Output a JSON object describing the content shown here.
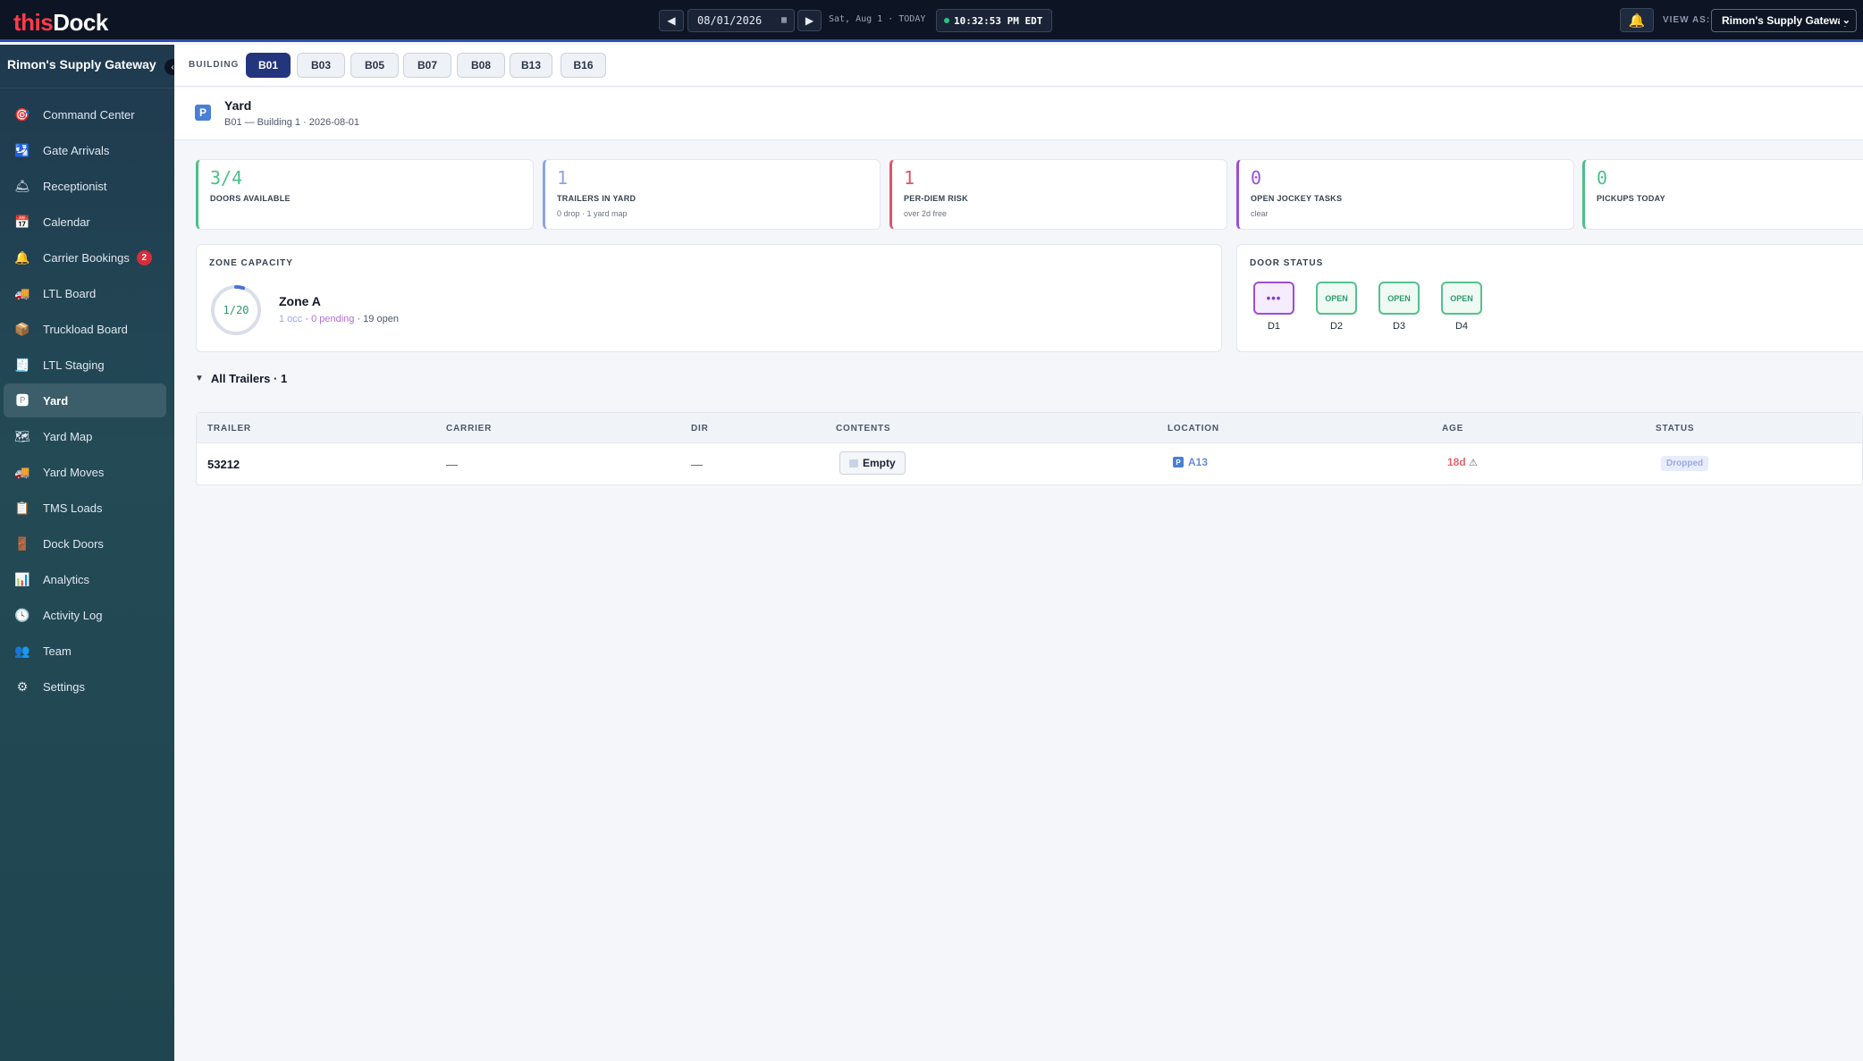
{
  "topbar": {
    "logo_part1": "this",
    "logo_part2": "Dock",
    "prev_label": "◀",
    "next_label": "▶",
    "date_value": "08/01/2026",
    "day_text": "Sat, Aug 1 · TODAY",
    "clock": "10:32:53 PM EDT",
    "view_as_label": "VIEW AS:",
    "view_as_value": "Rimon's Supply Gateway"
  },
  "sidebar": {
    "org_name": "Rimon's Supply Gateway",
    "items": [
      {
        "label": "Command Center",
        "icon": "🎯"
      },
      {
        "label": "Gate Arrivals",
        "icon": "🛂"
      },
      {
        "label": "Receptionist",
        "icon": "🛎"
      },
      {
        "label": "Calendar",
        "icon": "📅"
      },
      {
        "label": "Carrier Bookings",
        "icon": "🔔",
        "badge": "2"
      },
      {
        "label": "LTL Board",
        "icon": "🚚"
      },
      {
        "label": "Truckload Board",
        "icon": "📦"
      },
      {
        "label": "LTL Staging",
        "icon": "🧾"
      },
      {
        "label": "Yard",
        "icon": "🅿"
      },
      {
        "label": "Yard Map",
        "icon": "🗺"
      },
      {
        "label": "Yard Moves",
        "icon": "🚚"
      },
      {
        "label": "TMS Loads",
        "icon": "📋"
      },
      {
        "label": "Dock Doors",
        "icon": "🚪"
      },
      {
        "label": "Analytics",
        "icon": "📊"
      },
      {
        "label": "Activity Log",
        "icon": "🕓"
      },
      {
        "label": "Team",
        "icon": "👥"
      },
      {
        "label": "Settings",
        "icon": "⚙"
      }
    ],
    "active_item": "Yard"
  },
  "buildings": {
    "label": "BUILDING",
    "tabs": [
      "B01",
      "B03",
      "B05",
      "B07",
      "B08",
      "B13",
      "B16"
    ],
    "active": "B01"
  },
  "page": {
    "icon": "P",
    "title": "Yard",
    "subtitle": "B01 — Building 1 · 2026-08-01"
  },
  "stats": [
    {
      "value": "3/4",
      "label": "DOORS AVAILABLE",
      "sub": "",
      "color": "#4cbf8a"
    },
    {
      "value": "1",
      "label": "TRAILERS IN YARD",
      "sub": "0 drop · 1 yard map",
      "color": "#8fa2e6"
    },
    {
      "value": "1",
      "label": "PER-DIEM RISK",
      "sub": "over 2d free",
      "color": "#e0536a"
    },
    {
      "value": "0",
      "label": "OPEN JOCKEY TASKS",
      "sub": "clear",
      "color": "#9b4fd6"
    },
    {
      "value": "0",
      "label": "PICKUPS TODAY",
      "sub": "",
      "color": "#4cbf8a"
    }
  ],
  "zone_capacity": {
    "title": "ZONE CAPACITY",
    "ring_text": "1/20",
    "fill_fraction": 0.05,
    "zone_name": "Zone A",
    "occ": "1 occ",
    "sep1": " · ",
    "pending": "0 pending",
    "open": " · 19 open"
  },
  "door_status": {
    "title": "DOOR STATUS",
    "doors": [
      {
        "name": "D1",
        "state": "•••"
      },
      {
        "name": "D2",
        "state": "OPEN"
      },
      {
        "name": "D3",
        "state": "OPEN"
      },
      {
        "name": "D4",
        "state": "OPEN"
      }
    ]
  },
  "trailers_section": {
    "toggle_icon": "▼",
    "title": "All Trailers · 1"
  },
  "table": {
    "headers": [
      "TRAILER",
      "CARRIER",
      "DIR",
      "CONTENTS",
      "LOCATION",
      "AGE",
      "STATUS"
    ],
    "rows": [
      {
        "trailer": "53212",
        "carrier": "—",
        "dir": "—",
        "contents": "Empty",
        "location_icon": "P",
        "location": "A13",
        "age": "18d",
        "age_warn": "⚠",
        "status": "Dropped"
      }
    ]
  }
}
